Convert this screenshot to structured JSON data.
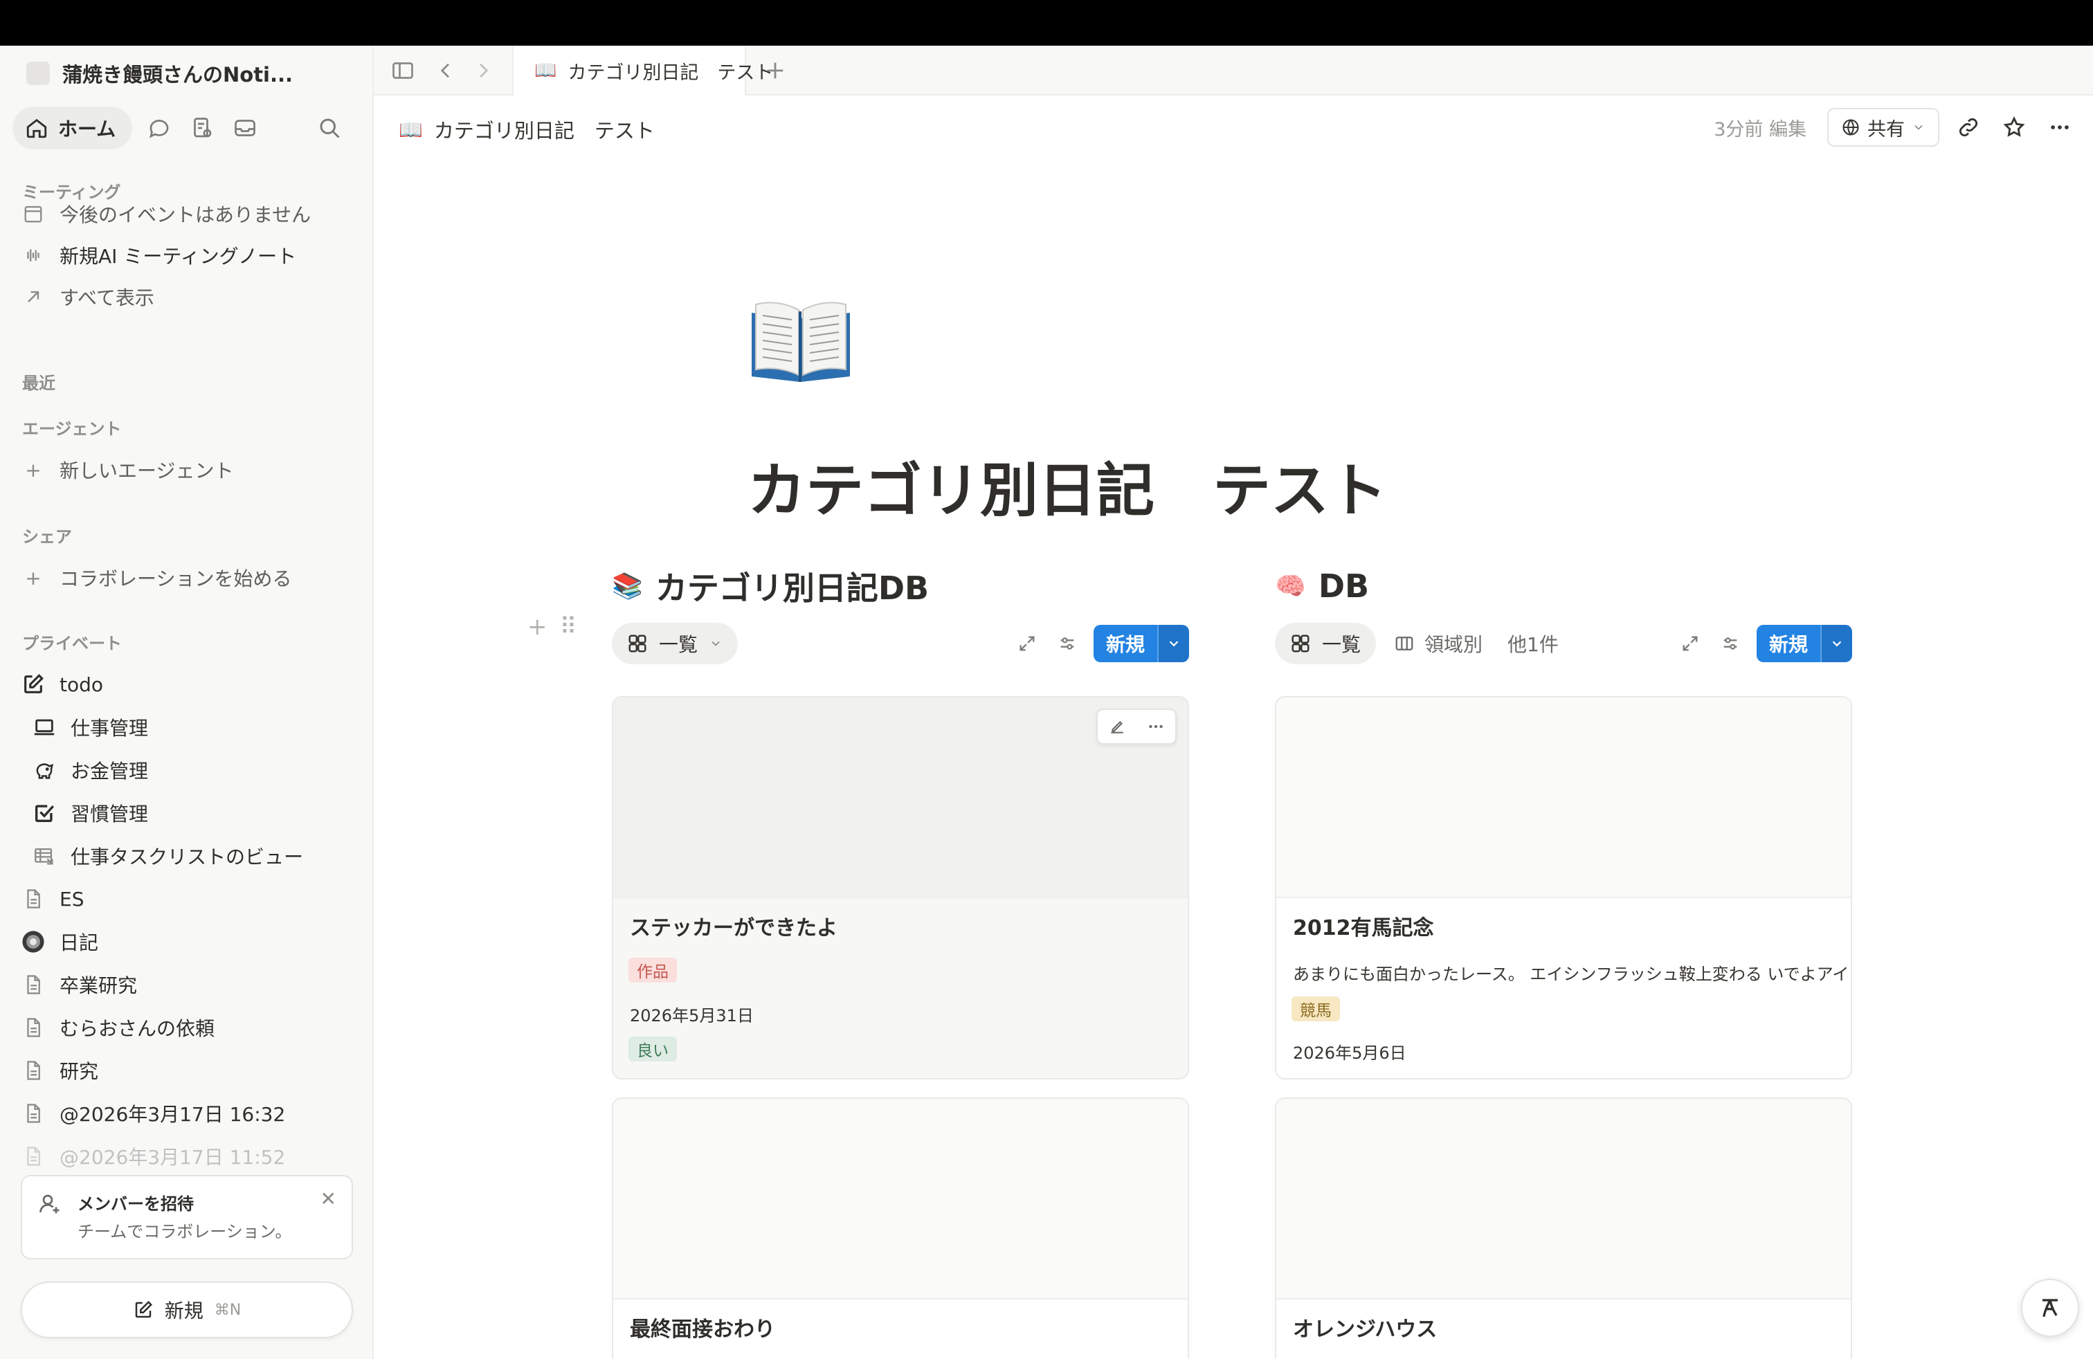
{
  "colors": {
    "accent": "#2383e2",
    "sidebar_bg": "#f8f8f7",
    "tag_work": "#fadfdd",
    "tag_good": "#dfece4",
    "tag_horse": "#f7e7c2"
  },
  "sidebar": {
    "workspace_name": "蒲焼き饅頭さんのNoti...",
    "home_label": "ホーム",
    "nav_icons": [
      "chat-bubble-icon",
      "meeting-notes-icon",
      "inbox-icon",
      "search-icon"
    ],
    "meetings_title": "ミーティング",
    "meeting_items": [
      {
        "label": "今後のイベントはありません",
        "icon": "calendar-icon"
      },
      {
        "label": "新規AI ミーティングノート",
        "icon": "waveform-icon"
      },
      {
        "label": "すべて表示",
        "icon": "arrow-up-right-icon"
      }
    ],
    "recent_title": "最近",
    "agent_title": "エージェント",
    "agent_item": "新しいエージェント",
    "share_title": "シェア",
    "share_item": "コラボレーションを始める",
    "private_title": "プライベート",
    "private_items": [
      {
        "label": "todo",
        "icon": "edit-square-icon"
      },
      {
        "label": "仕事管理",
        "icon": "laptop-icon"
      },
      {
        "label": "お金管理",
        "icon": "piggy-bank-icon"
      },
      {
        "label": "習慣管理",
        "icon": "checkbox-icon"
      },
      {
        "label": "仕事タスクリストのビュー",
        "icon": "table-icon"
      },
      {
        "label": "ES",
        "icon": "page-icon"
      },
      {
        "label": "日記",
        "icon": "globe-avatar-icon"
      },
      {
        "label": "卒業研究",
        "icon": "page-icon"
      },
      {
        "label": "むらおさんの依頼",
        "icon": "page-icon"
      },
      {
        "label": "研究",
        "icon": "page-icon"
      },
      {
        "label": "@2026年3月17日 16:32",
        "icon": "page-icon"
      },
      {
        "label": "@2026年3月17日 11:52",
        "icon": "page-icon"
      }
    ],
    "invite_title": "メンバーを招待",
    "invite_sub": "チームでコラボレーション。",
    "new_label": "新規",
    "new_shortcut": "⌘N"
  },
  "tabbar": {
    "tab_label": "カテゴリ別日記　テスト"
  },
  "header": {
    "breadcrumb": "カテゴリ別日記　テスト",
    "edited": "3分前 編集",
    "share_label": "共有"
  },
  "page": {
    "title": "カテゴリ別日記　テスト",
    "icon": "open-book-icon"
  },
  "db_left": {
    "emoji": "📚",
    "title": "カテゴリ別日記DB",
    "view_label": "一覧",
    "new_label": "新規",
    "cards": [
      {
        "name": "ステッカーができたよ",
        "tag": "作品",
        "date": "2026年5月31日",
        "rating": "良い"
      },
      {
        "name": "最終面接おわり"
      }
    ]
  },
  "db_right": {
    "emoji": "🧠",
    "title": "DB",
    "view_label": "一覧",
    "view2_label": "領域別",
    "more_label": "他1件",
    "new_label": "新規",
    "cards": [
      {
        "name": "2012有馬記念",
        "desc": "あまりにも面白かったレース。 エイシンフラッシュ鞍上変わる いでよアイフ",
        "tag": "競馬",
        "date": "2026年5月6日"
      },
      {
        "name": "オレンジハウス"
      }
    ]
  }
}
